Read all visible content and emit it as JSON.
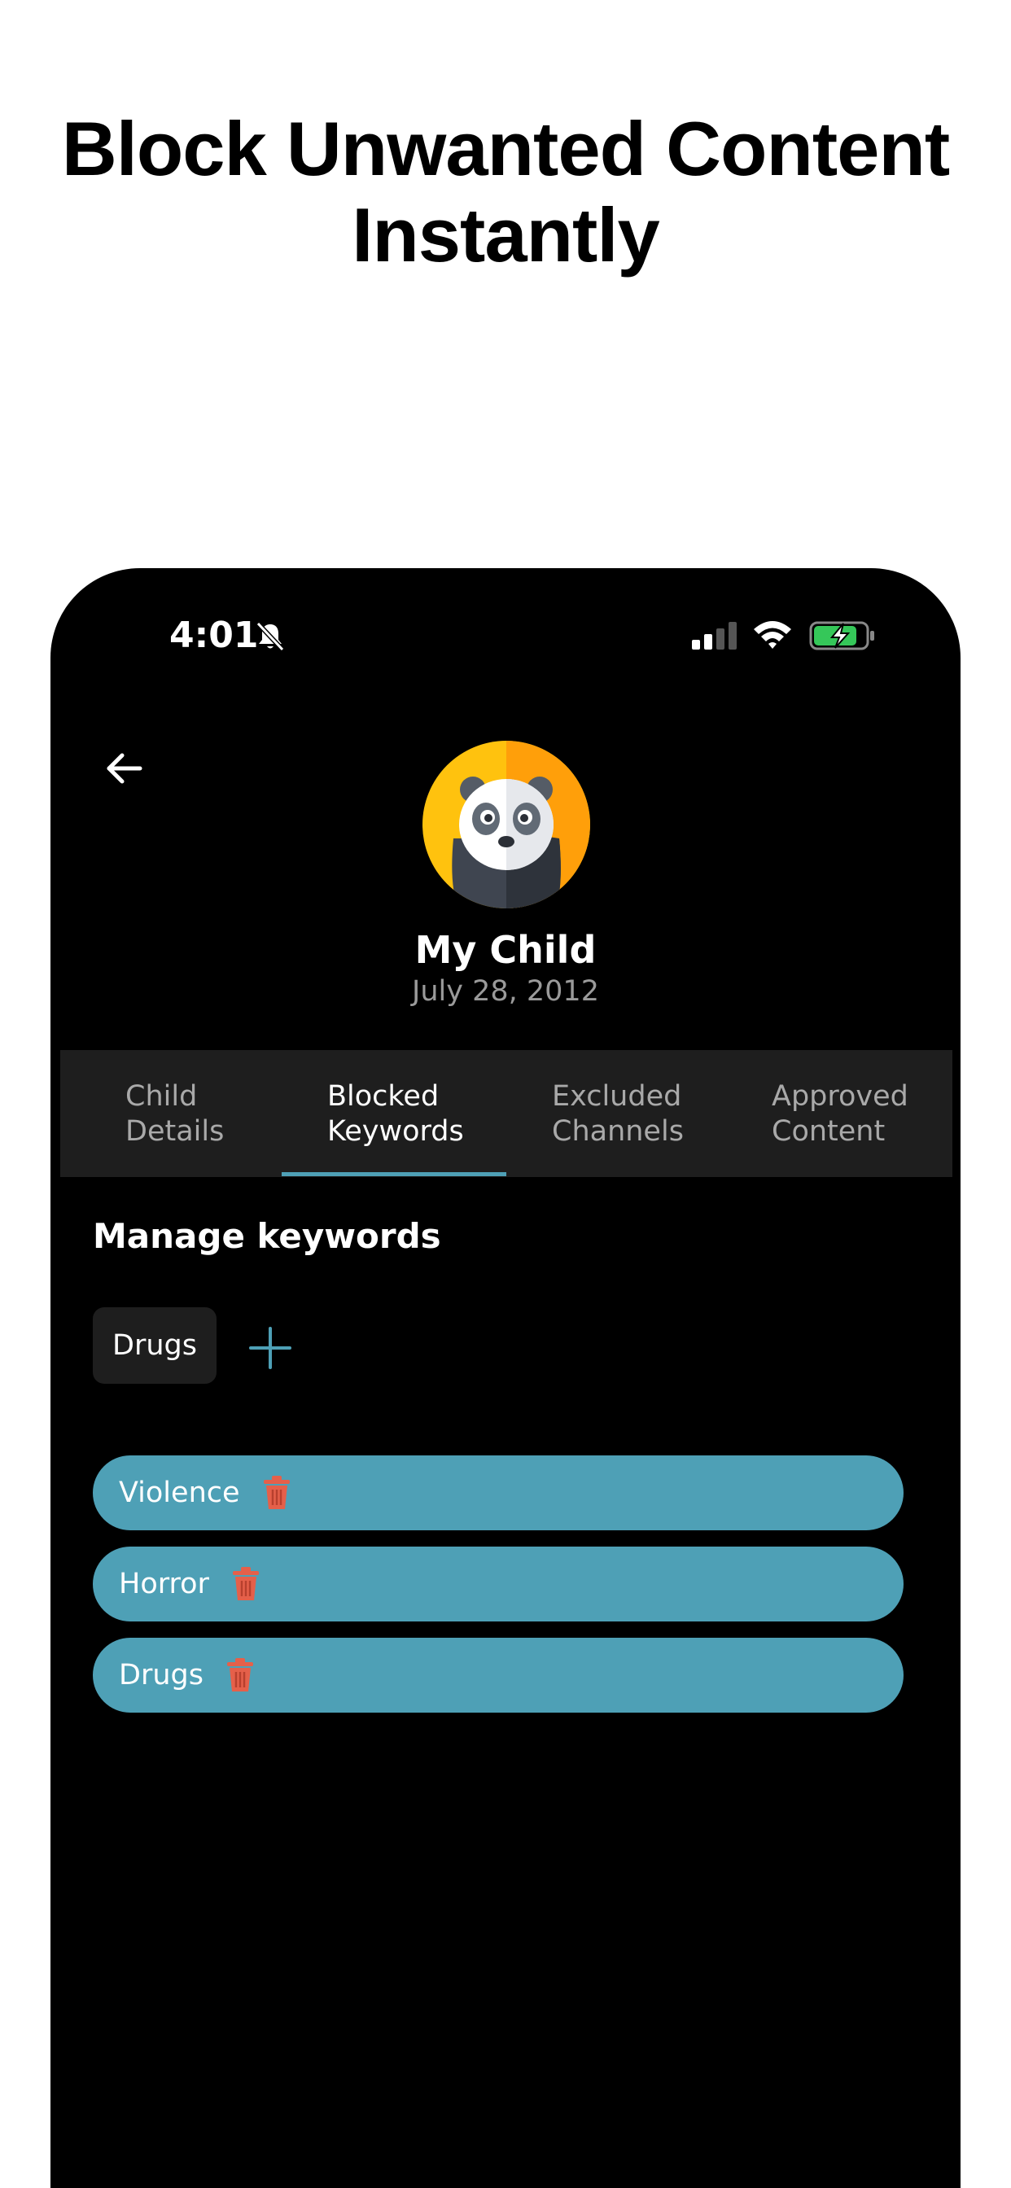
{
  "headline": {
    "line1": "Block Unwanted Content",
    "line2": "Instantly"
  },
  "status_bar": {
    "time": "4:01"
  },
  "profile": {
    "name": "My Child",
    "dob": "July 28, 2012"
  },
  "tabs": [
    {
      "line1": "Child",
      "line2": "Details",
      "active": false
    },
    {
      "line1": "Blocked",
      "line2": "Keywords",
      "active": true
    },
    {
      "line1": "Excluded",
      "line2": "Channels",
      "active": false
    },
    {
      "line1": "Approved",
      "line2": "Content",
      "active": false
    }
  ],
  "manage": {
    "title": "Manage keywords",
    "input_value": "Drugs"
  },
  "keywords": [
    {
      "label": "Violence"
    },
    {
      "label": "Horror"
    },
    {
      "label": "Drugs"
    }
  ],
  "colors": {
    "accent": "#4ea0b6",
    "delete": "#e5604a",
    "panel": "#1e1e1e",
    "battery_charge": "#35c759"
  },
  "icons": [
    "back-arrow-icon",
    "bell-slash-icon",
    "signal-icon",
    "wifi-icon",
    "battery-charging-icon",
    "panda-avatar",
    "plus-icon",
    "trash-icon"
  ]
}
